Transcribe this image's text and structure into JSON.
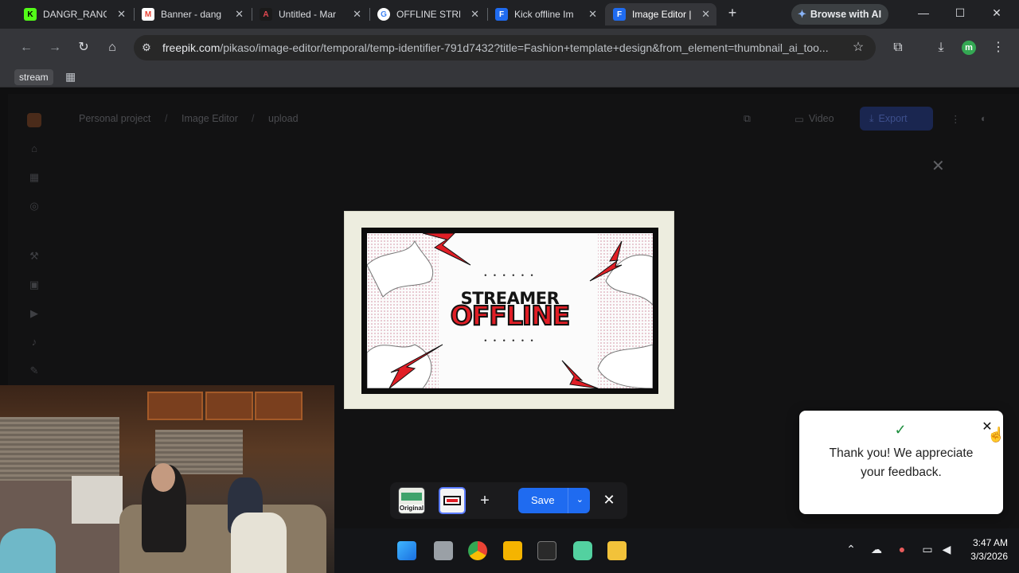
{
  "browser": {
    "tabs": [
      {
        "title": "DANGR_RANG",
        "favicon": "kick-icon",
        "color": "#53fc18"
      },
      {
        "title": "Banner - dang",
        "favicon": "gmail-icon",
        "color": "#ea4335"
      },
      {
        "title": "Untitled - Mar",
        "favicon": "adobe-icon",
        "color": "#1a1a1a"
      },
      {
        "title": "OFFLINE STRE",
        "favicon": "google-icon",
        "color": "#4285f4"
      },
      {
        "title": "Kick offline Im",
        "favicon": "freepik-icon",
        "color": "#1f6bf0"
      },
      {
        "title": "Image Editor |",
        "favicon": "freepik-icon",
        "color": "#1f6bf0"
      }
    ],
    "new_tab": "+",
    "browse_ai": "Browse with AI",
    "url_host": "freepik.com",
    "url_path": "/pikaso/image-editor/temporal/temp-identifier-791d7432?title=Fashion+template+design&from_element=thumbnail_ai_too...",
    "profile_initial": "m",
    "bookmarks": {
      "stream": "stream"
    }
  },
  "app": {
    "breadcrumb": [
      "Personal project",
      "Image Editor",
      "upload"
    ],
    "video_label": "Video",
    "export_label": "Export"
  },
  "canvas": {
    "line1": "STREAMER",
    "line2": "OFFLINE",
    "dots": "• • • • • •"
  },
  "editor_bar": {
    "original_label": "Original",
    "add_label": "+",
    "save_label": "Save",
    "close_label": "✕"
  },
  "toast": {
    "message": "Thank you! We appreciate your feedback.",
    "close_label": "✕"
  },
  "taskbar": {
    "time": "3:47 AM",
    "date": "3/3/2026"
  }
}
